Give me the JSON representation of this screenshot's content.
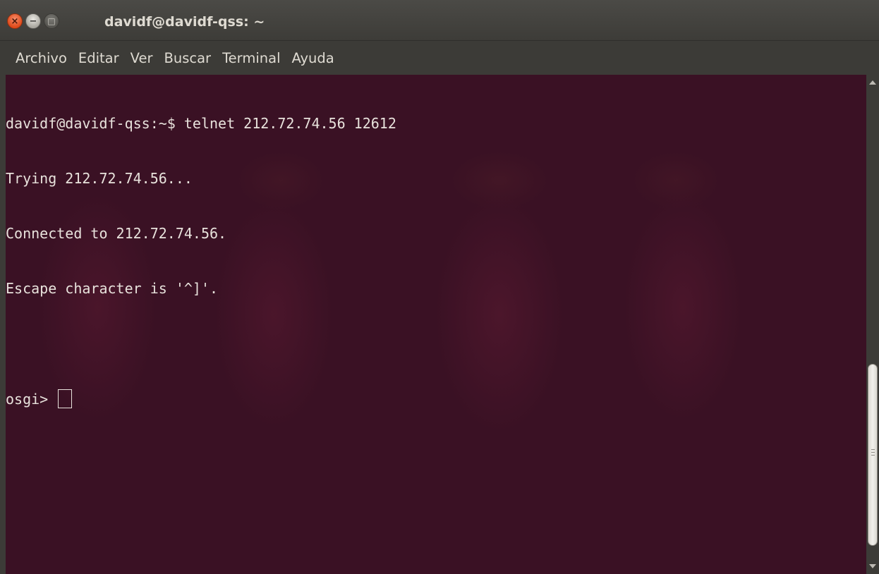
{
  "window": {
    "title": "davidf@davidf-qss: ~",
    "controls": {
      "close_glyph": "×",
      "minimize_glyph": "−",
      "maximize_glyph": "□"
    }
  },
  "menubar": {
    "items": [
      {
        "label": "Archivo"
      },
      {
        "label": "Editar"
      },
      {
        "label": "Ver"
      },
      {
        "label": "Buscar"
      },
      {
        "label": "Terminal"
      },
      {
        "label": "Ayuda"
      }
    ]
  },
  "terminal": {
    "lines": [
      "davidf@davidf-qss:~$ telnet 212.72.74.56 12612",
      "Trying 212.72.74.56...",
      "Connected to 212.72.74.56.",
      "Escape character is '^]'.",
      ""
    ],
    "prompt": "osgi> "
  },
  "colors": {
    "titlebar": "#3c3b37",
    "terminal_bg": "#3a1124",
    "text": "#e8e2dc",
    "close_button": "#df4a1a"
  }
}
